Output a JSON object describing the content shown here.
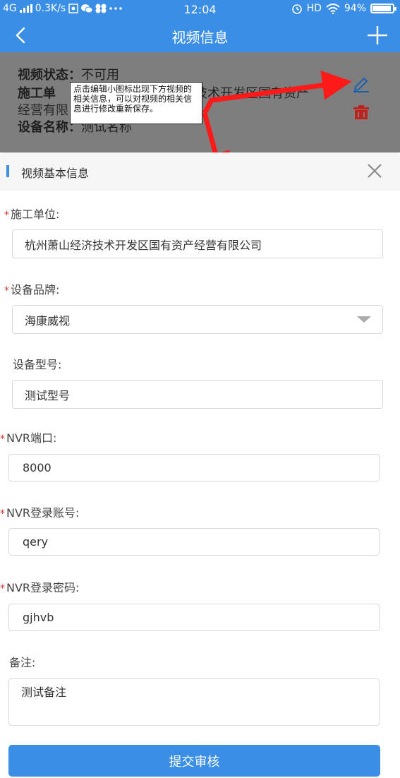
{
  "status_bar": {
    "network": "4G",
    "speed": "0.3K/s",
    "time": "12:04",
    "hd": "HD",
    "battery_percent": "94%",
    "battery_level": 0.94
  },
  "header": {
    "title": "视频信息"
  },
  "info": {
    "status_label": "视频状态：",
    "status_value": "不可用",
    "unit_label": "施工单",
    "unit_value_tail": "技术开发区国有资产",
    "unit_value_line2": "经营有限",
    "device_label": "设备名称：",
    "device_value": "测试名称"
  },
  "annotation": {
    "text": "点击编辑小图标出现下方视频的相关信息，可以对视频的相关信息进行修改重新保存。"
  },
  "sheet": {
    "title": "视频基本信息",
    "fields": {
      "unit": {
        "label": "施工单位:",
        "value": "杭州萧山经济技术开发区国有资产经营有限公司"
      },
      "brand": {
        "label": "设备品牌:",
        "value": "海康威视"
      },
      "model": {
        "label": "设备型号:",
        "value": "测试型号"
      },
      "nvr_port": {
        "label": "NVR端口:",
        "value": "8000"
      },
      "nvr_account": {
        "label": "NVR登录账号:",
        "value": "qery"
      },
      "nvr_password": {
        "label": "NVR登录密码:",
        "value": "gjhvb"
      },
      "remark": {
        "label": "备注:",
        "value": "测试备注"
      }
    },
    "required_mark": "*",
    "submit_label": "提交审核"
  },
  "colors": {
    "primary": "#3a8ee6",
    "required": "#e0352b",
    "delete": "#c0201b",
    "arrow": "#ff1a1a"
  },
  "icons": {
    "back": "chevron-left-icon",
    "add": "plus-icon",
    "edit": "pencil-icon",
    "delete": "trash-icon",
    "close": "close-icon",
    "dropdown": "caret-down-icon"
  }
}
